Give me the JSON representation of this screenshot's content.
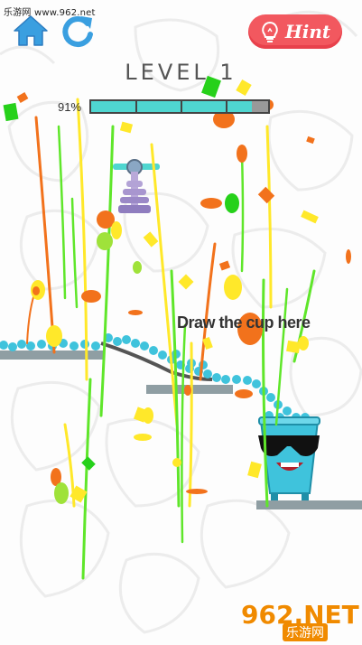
{
  "watermark_top": "乐游网 www.962.net",
  "hint": {
    "label": "Hint"
  },
  "level": {
    "title": "LEVEL 1"
  },
  "progress": {
    "percent_label": "91%",
    "value": 0.91
  },
  "hint_text": "Draw the cup here",
  "watermark_bottom": {
    "number": "962.NET",
    "name": "乐游网"
  },
  "colors": {
    "accent_red": "#f2585f",
    "cup_cyan": "#3fc3dc",
    "bar_fill": "#4fd6d0",
    "icon_blue": "#3a9fe0"
  }
}
